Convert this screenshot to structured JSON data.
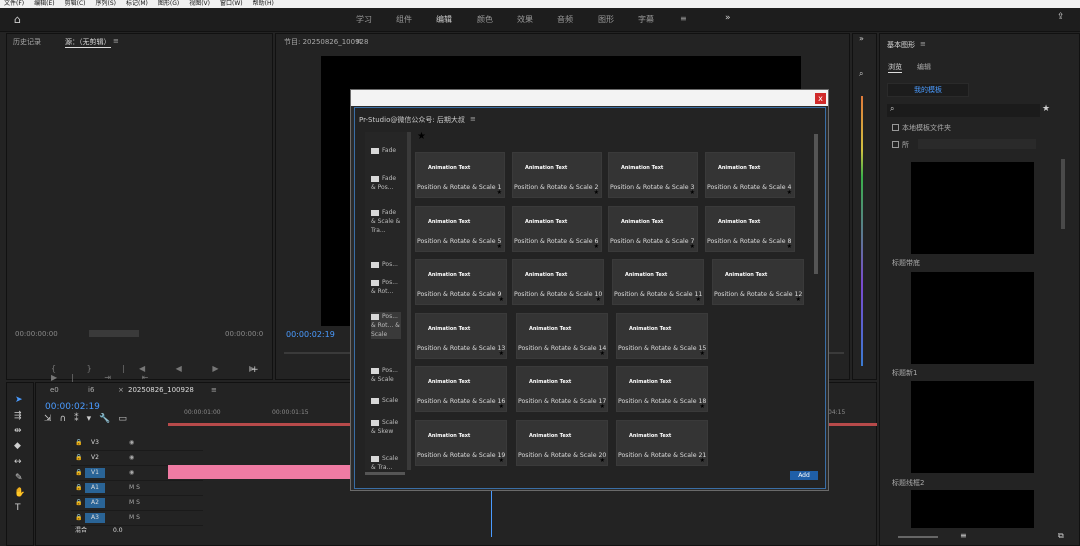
{
  "menubar": [
    "文件(F)",
    "编辑(E)",
    "剪辑(C)",
    "序列(S)",
    "标记(M)",
    "图形(G)",
    "视图(V)",
    "窗口(W)",
    "帮助(H)"
  ],
  "workspaces": [
    "学习",
    "组件",
    "编辑",
    "颜色",
    "效果",
    "音频",
    "图形",
    "字幕",
    "≡"
  ],
  "left_panel": {
    "tab1": "历史记录",
    "tab2": "源：（无剪辑）",
    "menu": "≡",
    "time_left": "00:00:00:00",
    "time_right": "00:00:00:0"
  },
  "program": {
    "title": "节目: 20250826_100928",
    "menu": "≡",
    "timecode": "00:00:02:19"
  },
  "timeline": {
    "tab_a": "e0",
    "tab_b": "i6",
    "tab_seq": "20250826_100928",
    "menu": "≡",
    "timecode": "00:00:02:19",
    "ruler": [
      "00:00:01:00",
      "00:00:01:15",
      "04:15"
    ],
    "tracks": [
      {
        "name": "V3",
        "kind": "video"
      },
      {
        "name": "V2",
        "kind": "video"
      },
      {
        "name": "V1",
        "kind": "video"
      },
      {
        "name": "A1",
        "kind": "audio"
      },
      {
        "name": "A2",
        "kind": "audio"
      },
      {
        "name": "A3",
        "kind": "audio"
      }
    ],
    "master": {
      "label": "混合",
      "value": "0.0"
    },
    "clip_color": "#f07ba3"
  },
  "essential_graphics": {
    "title": "基本图形",
    "menu": "≡",
    "tab_browse": "浏览",
    "tab_edit": "编辑",
    "my_templates": "我的模板",
    "local_folder": "本地模板文件夹",
    "other": "所",
    "labels": [
      "标题带底",
      "标题新1",
      "标题线框2"
    ]
  },
  "dialog": {
    "title": "Pr-Studio@微信公众号: 后期大叔",
    "menu": "≡",
    "close": "x",
    "add": "Add",
    "folders": [
      "Fade",
      "Fade & Pos...",
      "Fade & Scale & Tra...",
      "Pos...",
      "Pos... & Rot...",
      "Pos... & Rot... & Scale",
      "Pos... & Scale",
      "Scale",
      "Scale & Skew",
      "Scale & Tra..."
    ],
    "card_title": "Animation Text",
    "cards": [
      "Position & Rotate & Scale 1",
      "Position & Rotate & Scale 2",
      "Position & Rotate & Scale 3",
      "Position & Rotate & Scale 4",
      "Position & Rotate & Scale 5",
      "Position & Rotate & Scale 6",
      "Position & Rotate & Scale 7",
      "Position & Rotate & Scale 8",
      "Position & Rotate & Scale 9",
      "Position & Rotate & Scale 10",
      "Position & Rotate & Scale 11",
      "Position & Rotate & Scale 12",
      "Position & Rotate & Scale 13",
      "Position & Rotate & Scale 14",
      "Position & Rotate & Scale 15",
      "Position & Rotate & Scale 16",
      "Position & Rotate & Scale 17",
      "Position & Rotate & Scale 18",
      "Position & Rotate & Scale 19",
      "Position & Rotate & Scale 20",
      "Position & Rotate & Scale 21"
    ]
  },
  "colors": {
    "accent": "#4a9bff",
    "close": "#d02a2a",
    "add": "#1f5fa8"
  }
}
